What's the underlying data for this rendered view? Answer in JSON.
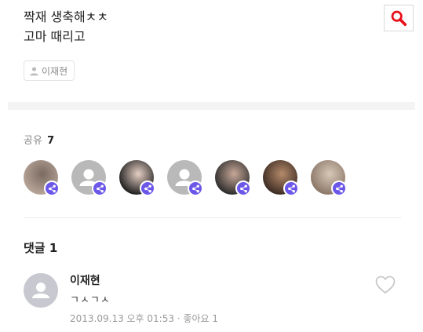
{
  "post": {
    "line1": "짝재 생축해ㅊㅊ",
    "line2": "고마 때리고",
    "author": "이재현"
  },
  "search_icon": "search-icon",
  "accent_color": "#e8101a",
  "share_color": "#6c58e8",
  "share": {
    "label": "공유",
    "count": "7",
    "avatars": [
      {
        "kind": "photo",
        "tone": [
          "#b9a69a",
          "#7a6a60"
        ]
      },
      {
        "kind": "default"
      },
      {
        "kind": "photo",
        "tone": [
          "#1c1c1c",
          "#e6cfc4"
        ]
      },
      {
        "kind": "default"
      },
      {
        "kind": "photo",
        "tone": [
          "#2a2a2a",
          "#c8a898"
        ]
      },
      {
        "kind": "photo",
        "tone": [
          "#3a2a22",
          "#b58a6a"
        ]
      },
      {
        "kind": "photo",
        "tone": [
          "#8a7565",
          "#d7c8b8"
        ]
      }
    ]
  },
  "comments": {
    "label": "댓글",
    "count": "1",
    "items": [
      {
        "author": "이재현",
        "text": "ㄱㅅㄱㅅ",
        "meta": "2013.09.13 오후 01:53 · 좋아요 1"
      }
    ]
  }
}
